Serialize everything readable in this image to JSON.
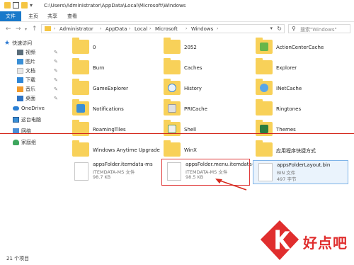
{
  "window": {
    "title": "C:\\Users\\Administrator\\AppData\\Local\\Microsoft\\Windows"
  },
  "ribbon": {
    "tabs": [
      "文件",
      "主页",
      "共享",
      "查看"
    ]
  },
  "address": {
    "crumbs": [
      "Administrator",
      "AppData",
      "Local",
      "Microsoft",
      "Windows"
    ]
  },
  "search": {
    "placeholder": "搜索\"Windows\""
  },
  "sidebar": {
    "quick_access": "快速访问",
    "items": [
      {
        "label": "视频",
        "icon": "video-folder-icon"
      },
      {
        "label": "图片",
        "icon": "pictures-folder-icon"
      },
      {
        "label": "文档",
        "icon": "documents-folder-icon"
      },
      {
        "label": "下载",
        "icon": "downloads-folder-icon"
      },
      {
        "label": "音乐",
        "icon": "music-folder-icon"
      },
      {
        "label": "桌面",
        "icon": "desktop-folder-icon"
      }
    ],
    "onedrive": "OneDrive",
    "this_pc": "这台电脑",
    "network": "网络",
    "homegroup": "家庭组"
  },
  "files": {
    "col1": [
      "0",
      "Burn",
      "GameExplorer",
      "Notifications",
      "RoamingTiles",
      "Windows Anytime Upgrade"
    ],
    "col2": [
      "2052",
      "Caches",
      "History",
      "PRICache",
      "Shell",
      "WinX"
    ],
    "col3": [
      "ActionCenterCache",
      "Explorer",
      "INetCache",
      "Ringtones",
      "Themes",
      "应用程序快捷方式"
    ],
    "tiles": [
      {
        "name": "appsFolder.itemdata-ms",
        "type": "ITEMDATA-MS 文件",
        "size": "98.7 KB"
      },
      {
        "name": "appsFolder.menu.itemdata-ms",
        "type": "ITEMDATA-MS 文件",
        "size": "98.5 KB"
      },
      {
        "name": "appsFolderLayout.bin",
        "type": "BIN 文件",
        "size": "497 字节"
      }
    ]
  },
  "status": {
    "count": "21 个项目"
  },
  "watermark": {
    "text": "好点吧"
  },
  "colors": {
    "accent": "#1979ca",
    "folder": "#f8d159",
    "annotation": "#d4281c"
  }
}
